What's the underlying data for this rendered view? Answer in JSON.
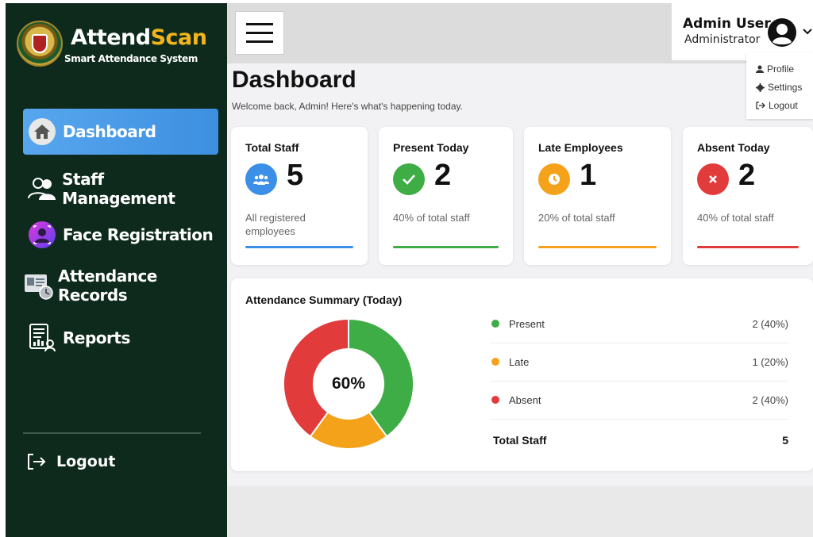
{
  "brand": {
    "name_part1": "Attend",
    "name_part2": "Scan",
    "subtitle": "Smart Attendance System"
  },
  "sidebar": {
    "items": [
      {
        "label": "Dashboard",
        "icon": "home-icon",
        "active": true
      },
      {
        "label": "Staff Management",
        "icon": "users-icon",
        "active": false
      },
      {
        "label": "Face Registration",
        "icon": "face-scan-icon",
        "active": false
      },
      {
        "label": "Attendance Records",
        "icon": "id-card-clock-icon",
        "active": false
      },
      {
        "label": "Reports",
        "icon": "report-icon",
        "active": false
      }
    ],
    "logout_label": "Logout"
  },
  "header": {
    "user_name": "Admin User",
    "user_role": "Administrator",
    "menu": [
      {
        "label": "Profile",
        "icon": "user-icon"
      },
      {
        "label": "Settings",
        "icon": "gear-icon"
      },
      {
        "label": "Logout",
        "icon": "sign-out-icon"
      }
    ]
  },
  "page": {
    "title": "Dashboard",
    "subtitle": "Welcome back, Admin! Here's what's happening today."
  },
  "stats": [
    {
      "label": "Total Staff",
      "value": "5",
      "note": "All registered employees",
      "color": "#3b8fe6",
      "icon": "users-icon"
    },
    {
      "label": "Present Today",
      "value": "2",
      "note": "40% of total staff",
      "color": "#3fad46",
      "icon": "check-icon"
    },
    {
      "label": "Late Employees",
      "value": "1",
      "note": "20% of total staff",
      "color": "#f5a21b",
      "icon": "clock-icon"
    },
    {
      "label": "Absent Today",
      "value": "2",
      "note": "40% of total staff",
      "color": "#e23b3b",
      "icon": "x-icon"
    }
  ],
  "summary": {
    "title": "Attendance Summary (Today)",
    "center_label": "60%",
    "legend": [
      {
        "label": "Present",
        "value": "2 (40%)",
        "color": "#3fad46"
      },
      {
        "label": "Late",
        "value": "1 (20%)",
        "color": "#f5a21b"
      },
      {
        "label": "Absent",
        "value": "2 (40%)",
        "color": "#e23b3b"
      }
    ],
    "total_label": "Total Staff",
    "total_value": "5"
  },
  "chart_data": {
    "type": "pie",
    "categories": [
      "Present",
      "Late",
      "Absent"
    ],
    "values": [
      2,
      1,
      2
    ],
    "colors": [
      "#3fad46",
      "#f5a21b",
      "#e23b3b"
    ],
    "title": "Attendance Summary (Today)"
  }
}
